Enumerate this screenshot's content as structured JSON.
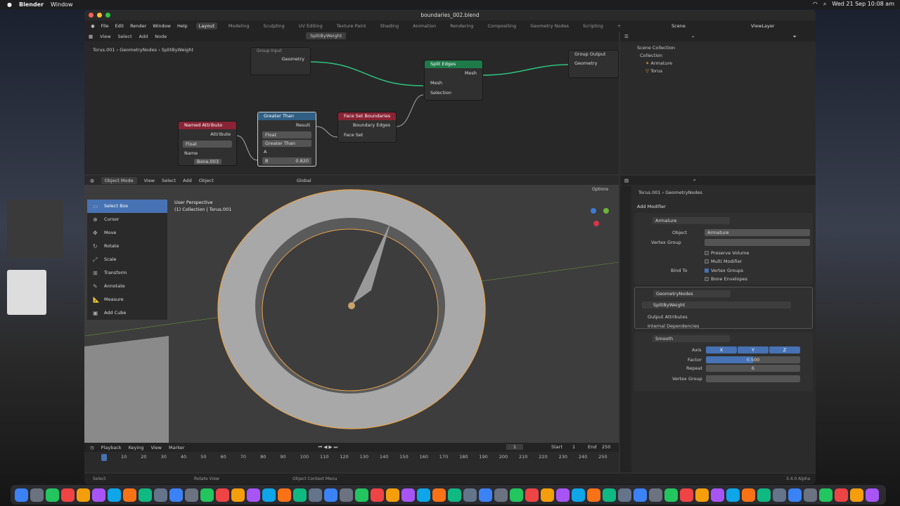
{
  "menubar": {
    "app": "Blender",
    "window": "Window",
    "clock": "Wed 21 Sep  10:08 am"
  },
  "window": {
    "title": "boundaries_002.blend"
  },
  "topbar": {
    "menus": [
      "File",
      "Edit",
      "Render",
      "Window",
      "Help"
    ],
    "workspaces": [
      "Layout",
      "Modeling",
      "Sculpting",
      "UV Editing",
      "Texture Paint",
      "Shading",
      "Animation",
      "Rendering",
      "Compositing",
      "Geometry Nodes",
      "Scripting"
    ],
    "active_workspace": "Layout",
    "scene": "Scene",
    "view_layer": "ViewLayer"
  },
  "node_editor": {
    "menus": [
      "View",
      "Select",
      "Add",
      "Node"
    ],
    "node_group": "SplitByWeight",
    "breadcrumb": [
      "Torus.001",
      "GeometryNodes",
      "SplitByWeight"
    ],
    "nodes": {
      "group_input": {
        "title": "Group Input",
        "out": "Geometry"
      },
      "split_edges": {
        "title": "Split Edges",
        "out": "Mesh",
        "in1": "Mesh",
        "in2": "Selection"
      },
      "group_output": {
        "title": "Group Output",
        "in": "Geometry"
      },
      "named_attribute": {
        "title": "Named Attribute",
        "out": "Attribute",
        "type": "Float",
        "name_label": "Name",
        "name_value": "Bone.003"
      },
      "greater_than": {
        "title": "Greater Than",
        "out": "Result",
        "type": "Float",
        "op": "Greater Than",
        "a": "A",
        "b": "B",
        "b_value": "0.820"
      },
      "face_set": {
        "title": "Face Set Boundaries",
        "out": "Boundary Edges",
        "in": "Face Set"
      }
    }
  },
  "outliner": {
    "title": "Scene Collection",
    "items": [
      "Collection",
      "Armature",
      "Torus"
    ]
  },
  "viewport": {
    "mode": "Object Mode",
    "menus": [
      "View",
      "Select",
      "Add",
      "Object"
    ],
    "orientation": "Global",
    "options": "Options",
    "overlay1": "User Perspective",
    "overlay2": "(1) Collection | Torus.001",
    "tools": [
      "Select Box",
      "Cursor",
      "Move",
      "Rotate",
      "Scale",
      "Transform",
      "Annotate",
      "Measure",
      "Add Cube"
    ]
  },
  "properties": {
    "breadcrumb": [
      "Torus.001",
      "GeometryNodes"
    ],
    "add_modifier": "Add Modifier",
    "armature": {
      "name": "Armature",
      "object_label": "Object",
      "object_value": "Armature",
      "vgroup_label": "Vertex Group",
      "preserve": "Preserve Volume",
      "multi": "Multi Modifier",
      "bindto": "Bind To",
      "vgroups": "Vertex Groups",
      "envelopes": "Bone Envelopes"
    },
    "geonodes": {
      "name": "GeometryNodes",
      "group": "SplitByWeight",
      "out_attr": "Output Attributes",
      "internal": "Internal Dependencies"
    },
    "smooth": {
      "name": "Smooth",
      "axis_label": "Axis",
      "x": "X",
      "y": "Y",
      "z": "Z",
      "factor_label": "Factor",
      "factor_value": "0.500",
      "repeat_label": "Repeat",
      "repeat_value": "6",
      "vgroup_label": "Vertex Group"
    }
  },
  "timeline": {
    "menus": [
      "Playback",
      "Keying",
      "View",
      "Marker"
    ],
    "current": "1",
    "start_label": "Start",
    "start": "1",
    "end_label": "End",
    "end": "250",
    "ticks": [
      "10",
      "20",
      "30",
      "40",
      "50",
      "60",
      "70",
      "80",
      "90",
      "100",
      "110",
      "120",
      "130",
      "140",
      "150",
      "160",
      "170",
      "180",
      "190",
      "200",
      "210",
      "220",
      "230",
      "240",
      "250"
    ]
  },
  "statusbar": {
    "select": "Select",
    "rotate": "Rotate View",
    "context": "Object Context Menu",
    "version": "3.4.0 Alpha"
  }
}
